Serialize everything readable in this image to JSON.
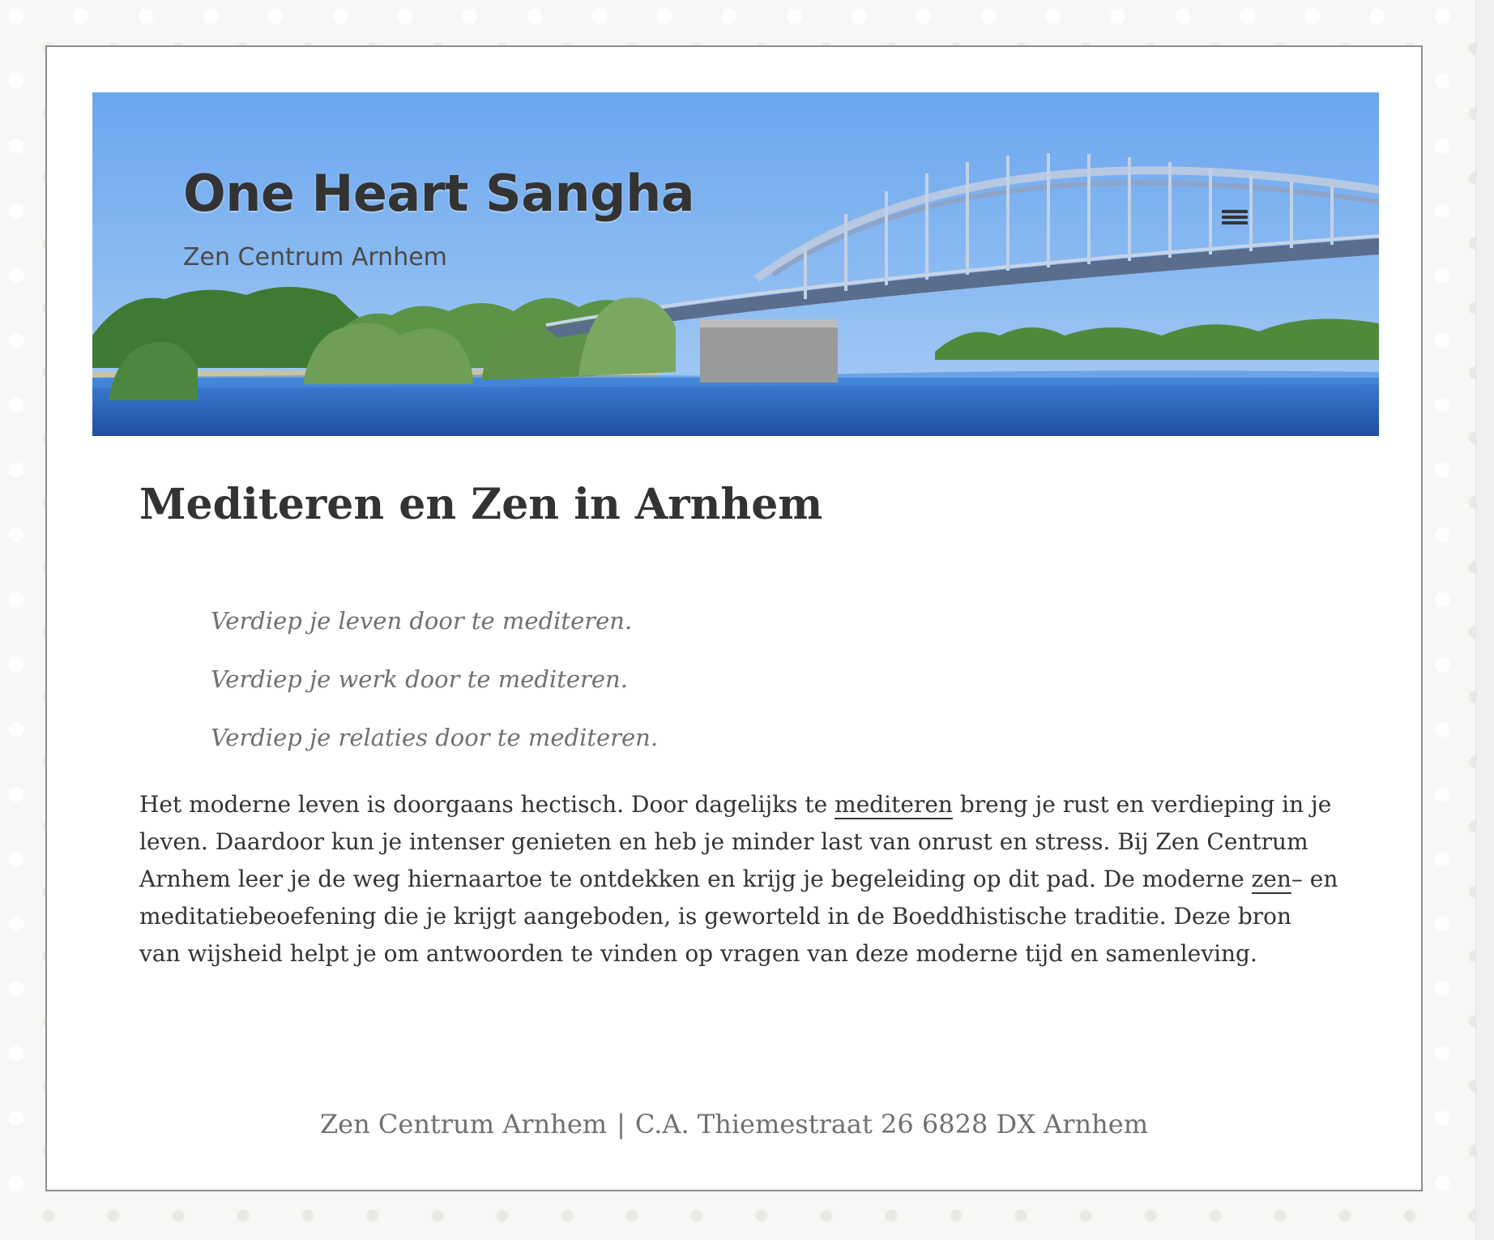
{
  "site": {
    "title": "One Heart Sangha",
    "subtitle": "Zen Centrum Arnhem"
  },
  "icons": {
    "menu": "hamburger-menu-icon"
  },
  "article": {
    "title": "Mediteren en Zen in Arnhem",
    "quotes": [
      "Verdiep je leven door te mediteren.",
      "Verdiep je werk door te mediteren.",
      "Verdiep je relaties door te mediteren."
    ],
    "paragraph": {
      "part1": "Het moderne leven is doorgaans hectisch. Door dagelijks te ",
      "link1": "mediteren",
      "part2": " breng je rust en verdieping in je leven. Daardoor kun je intenser genieten en heb je minder last van onrust en stress. Bij Zen Centrum Arnhem leer je de weg hiernaartoe te ontdekken en krijg je begeleiding op dit pad. De moderne ",
      "link2": "zen",
      "part3": "– en meditatiebeoefening die je krijgt aangeboden, is geworteld in de Boeddhistische traditie. Deze bron van wijsheid helpt je om antwoorden te vinden op vragen van deze moderne tijd en samenleving."
    }
  },
  "footer": {
    "name": "Zen Centrum Arnhem",
    "separator": "|",
    "address": "C.A. Thiemestraat 26 6828 DX Arnhem"
  },
  "colors": {
    "sky": "#5b9ae6",
    "water": "#2f6fc9",
    "bridge": "#9eb4d4",
    "trees": "#4f8a3c",
    "text": "#333333",
    "muted": "#707070"
  }
}
